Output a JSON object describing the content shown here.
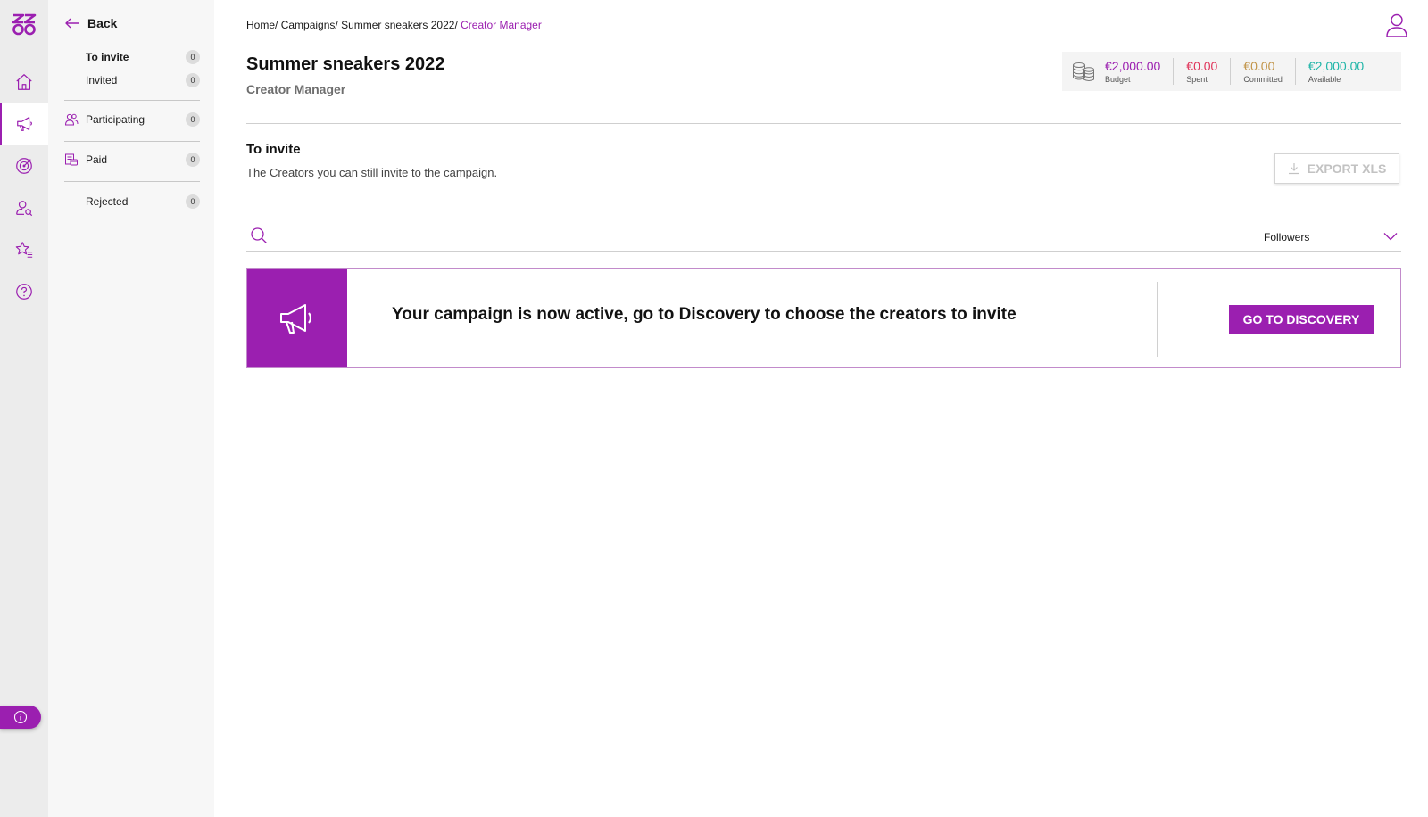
{
  "colors": {
    "accent": "#9b1fb0",
    "spent": "#e0345a",
    "committed": "#c2954a",
    "available": "#1fb5a8"
  },
  "rail": {
    "items": [
      {
        "icon": "home-icon"
      },
      {
        "icon": "megaphone-icon",
        "active": true
      },
      {
        "icon": "target-icon"
      },
      {
        "icon": "user-search-icon"
      },
      {
        "icon": "star-list-icon"
      },
      {
        "icon": "help-icon"
      }
    ],
    "info_icon": "info-icon"
  },
  "subnav": {
    "back_label": "Back",
    "items": [
      {
        "label": "To invite",
        "count": "0",
        "active": true
      },
      {
        "label": "Invited",
        "count": "0"
      },
      {
        "label": "Participating",
        "count": "0",
        "icon": "users-icon"
      },
      {
        "label": "Paid",
        "count": "0",
        "icon": "payment-icon"
      },
      {
        "label": "Rejected",
        "count": "0"
      }
    ]
  },
  "breadcrumb": {
    "items": [
      "Home/",
      "Campaigns/",
      "Summer sneakers 2022/"
    ],
    "current": "Creator Manager"
  },
  "header": {
    "title": "Summer sneakers 2022",
    "subtitle": "Creator Manager"
  },
  "budget": {
    "budget_value": "€2,000.00",
    "budget_label": "Budget",
    "spent_value": "€0.00",
    "spent_label": "Spent",
    "committed_value": "€0.00",
    "committed_label": "Committed",
    "available_value": "€2,000.00",
    "available_label": "Available"
  },
  "section": {
    "title": "To invite",
    "description": "The Creators you can still invite to the campaign.",
    "export_label": "EXPORT XLS"
  },
  "filters": {
    "search_value": "",
    "sort_selected": "Followers"
  },
  "banner": {
    "message": "Your campaign is now active, go to Discovery to choose the creators to invite",
    "cta_label": "GO TO DISCOVERY"
  }
}
